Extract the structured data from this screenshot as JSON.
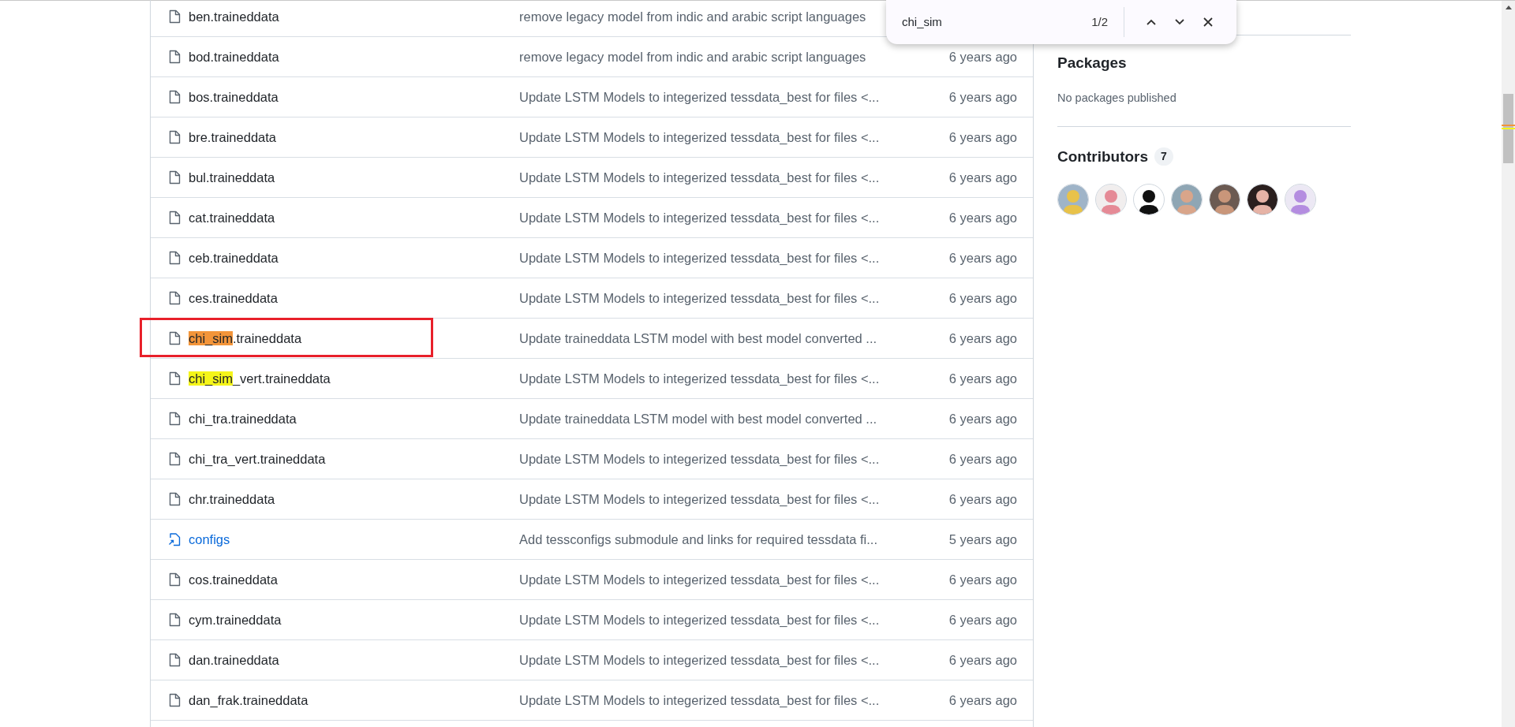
{
  "files": [
    {
      "kind": "file",
      "name_parts": [
        {
          "text": "ben.traineddata",
          "match": false
        }
      ],
      "message": "remove legacy model from indic and arabic script languages",
      "boxed": false
    },
    {
      "kind": "file",
      "name_parts": [
        {
          "text": "bod.traineddata",
          "match": false
        }
      ],
      "message": "remove legacy model from indic and arabic script languages",
      "age": "6 years ago",
      "boxed": false
    },
    {
      "kind": "file",
      "name_parts": [
        {
          "text": "bos.traineddata",
          "match": false
        }
      ],
      "message": "Update LSTM Models to integerized tessdata_best for files <...",
      "age": "6 years ago",
      "boxed": false
    },
    {
      "kind": "file",
      "name_parts": [
        {
          "text": "bre.traineddata",
          "match": false
        }
      ],
      "message": "Update LSTM Models to integerized tessdata_best for files <...",
      "age": "6 years ago",
      "boxed": false
    },
    {
      "kind": "file",
      "name_parts": [
        {
          "text": "bul.traineddata",
          "match": false
        }
      ],
      "message": "Update LSTM Models to integerized tessdata_best for files <...",
      "age": "6 years ago",
      "boxed": false
    },
    {
      "kind": "file",
      "name_parts": [
        {
          "text": "cat.traineddata",
          "match": false
        }
      ],
      "message": "Update LSTM Models to integerized tessdata_best for files <...",
      "age": "6 years ago",
      "boxed": false
    },
    {
      "kind": "file",
      "name_parts": [
        {
          "text": "ceb.traineddata",
          "match": false
        }
      ],
      "message": "Update LSTM Models to integerized tessdata_best for files <...",
      "age": "6 years ago",
      "boxed": false
    },
    {
      "kind": "file",
      "name_parts": [
        {
          "text": "ces.traineddata",
          "match": false
        }
      ],
      "message": "Update LSTM Models to integerized tessdata_best for files <...",
      "age": "6 years ago",
      "boxed": false
    },
    {
      "kind": "file",
      "name_parts": [
        {
          "text": "chi_sim",
          "match": true,
          "selected": true
        },
        {
          "text": ".traineddata",
          "match": false
        }
      ],
      "message": "Update traineddata LSTM model with best model converted ...",
      "age": "6 years ago",
      "boxed": true
    },
    {
      "kind": "file",
      "name_parts": [
        {
          "text": "chi_sim",
          "match": true,
          "selected": false
        },
        {
          "text": "_vert.traineddata",
          "match": false
        }
      ],
      "message": "Update LSTM Models to integerized tessdata_best for files <...",
      "age": "6 years ago",
      "boxed": false
    },
    {
      "kind": "file",
      "name_parts": [
        {
          "text": "chi_tra.traineddata",
          "match": false
        }
      ],
      "message": "Update traineddata LSTM model with best model converted ...",
      "age": "6 years ago",
      "boxed": false
    },
    {
      "kind": "file",
      "name_parts": [
        {
          "text": "chi_tra_vert.traineddata",
          "match": false
        }
      ],
      "message": "Update LSTM Models to integerized tessdata_best for files <...",
      "age": "6 years ago",
      "boxed": false
    },
    {
      "kind": "file",
      "name_parts": [
        {
          "text": "chr.traineddata",
          "match": false
        }
      ],
      "message": "Update LSTM Models to integerized tessdata_best for files <...",
      "age": "6 years ago",
      "boxed": false
    },
    {
      "kind": "submodule",
      "name_parts": [
        {
          "text": "configs",
          "match": false
        }
      ],
      "message": "Add tessconfigs submodule and links for required tessdata fi...",
      "age": "5 years ago",
      "boxed": false
    },
    {
      "kind": "file",
      "name_parts": [
        {
          "text": "cos.traineddata",
          "match": false
        }
      ],
      "message": "Update LSTM Models to integerized tessdata_best for files <...",
      "age": "6 years ago",
      "boxed": false
    },
    {
      "kind": "file",
      "name_parts": [
        {
          "text": "cym.traineddata",
          "match": false
        }
      ],
      "message": "Update LSTM Models to integerized tessdata_best for files <...",
      "age": "6 years ago",
      "boxed": false
    },
    {
      "kind": "file",
      "name_parts": [
        {
          "text": "dan.traineddata",
          "match": false
        }
      ],
      "message": "Update LSTM Models to integerized tessdata_best for files <...",
      "age": "6 years ago",
      "boxed": false
    },
    {
      "kind": "file",
      "name_parts": [
        {
          "text": "dan_frak.traineddata",
          "match": false
        }
      ],
      "message": "Update LSTM Models to integerized tessdata_best for files <...",
      "age": "6 years ago",
      "boxed": false
    }
  ],
  "sidebar": {
    "packages": {
      "title": "Packages",
      "text": "No packages published"
    },
    "contributors": {
      "title": "Contributors",
      "count": "7"
    }
  },
  "find_bar": {
    "query": "chi_sim",
    "result": "1/2"
  }
}
